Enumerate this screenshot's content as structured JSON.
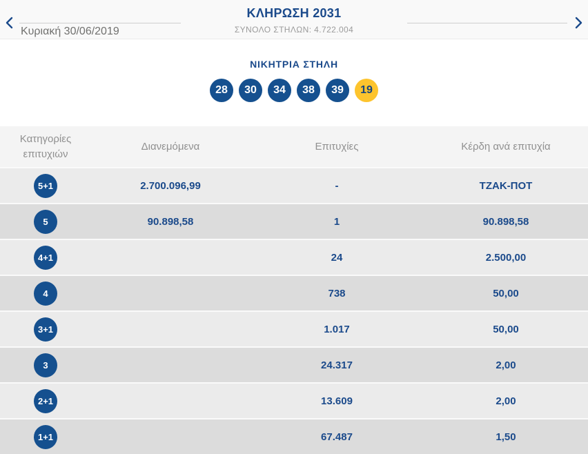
{
  "header": {
    "title": "ΚΛΗΡΩΣΗ 2031",
    "subtitle": "ΣΥΝΟΛΟ ΣΤΗΛΩΝ: 4.722.004",
    "date": "Κυριακή 30/06/2019",
    "icons": {
      "prev": "chevron-left",
      "next": "chevron-right"
    }
  },
  "winning": {
    "title": "ΝΙΚΗΤΡΙΑ ΣΤΗΛΗ",
    "numbers": [
      "28",
      "30",
      "34",
      "38",
      "39"
    ],
    "joker": "19"
  },
  "table": {
    "headers": [
      "Κατηγορίες επιτυχιών",
      "Διανεμόμενα",
      "Επιτυχίες",
      "Κέρδη ανά επιτυχία"
    ],
    "rows": [
      {
        "category": "5+1",
        "distributed": "2.700.096,99",
        "wins": "-",
        "prize": "ΤΖΑΚ-ΠΟΤ"
      },
      {
        "category": "5",
        "distributed": "90.898,58",
        "wins": "1",
        "prize": "90.898,58"
      },
      {
        "category": "4+1",
        "distributed": "",
        "wins": "24",
        "prize": "2.500,00"
      },
      {
        "category": "4",
        "distributed": "",
        "wins": "738",
        "prize": "50,00"
      },
      {
        "category": "3+1",
        "distributed": "",
        "wins": "1.017",
        "prize": "50,00"
      },
      {
        "category": "3",
        "distributed": "",
        "wins": "24.317",
        "prize": "2,00"
      },
      {
        "category": "2+1",
        "distributed": "",
        "wins": "13.609",
        "prize": "2,00"
      },
      {
        "category": "1+1",
        "distributed": "",
        "wins": "67.487",
        "prize": "1,50"
      }
    ]
  },
  "colors": {
    "navy": "#1b4a8b",
    "ball_blue": "#15508f",
    "joker_yellow": "#fdc42d",
    "row_light": "#ebebeb",
    "row_dark": "#dcdcdc",
    "header_gray": "#f4f4f4"
  }
}
